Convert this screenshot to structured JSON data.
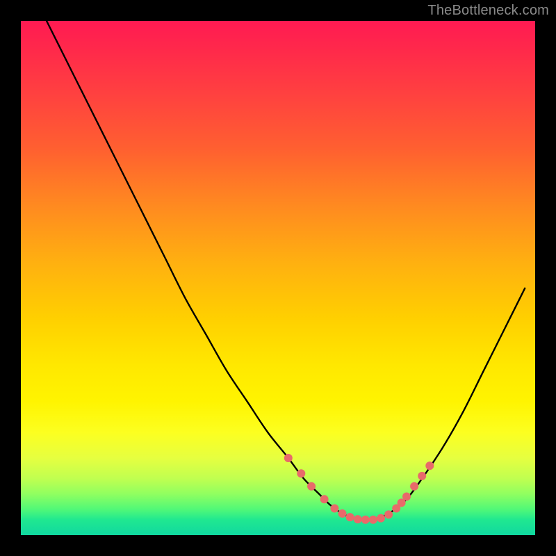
{
  "watermark": "TheBottleneck.com",
  "chart_data": {
    "type": "line",
    "title": "",
    "xlabel": "",
    "ylabel": "",
    "xlim": [
      0,
      100
    ],
    "ylim": [
      0,
      100
    ],
    "series": [
      {
        "name": "bottleneck-curve",
        "x": [
          5,
          8,
          12,
          16,
          20,
          24,
          28,
          32,
          36,
          40,
          44,
          48,
          52,
          55,
          58,
          60,
          62,
          64,
          66,
          68,
          70,
          72,
          75,
          78,
          82,
          86,
          90,
          94,
          98
        ],
        "y": [
          100,
          94,
          86,
          78,
          70,
          62,
          54,
          46,
          39,
          32,
          26,
          20,
          15,
          11,
          8,
          6,
          4.5,
          3.5,
          3,
          3,
          3.5,
          4.5,
          7,
          11,
          17,
          24,
          32,
          40,
          48
        ]
      }
    ],
    "markers": {
      "name": "highlight-dots",
      "color": "#e86a6a",
      "x": [
        52,
        54.5,
        56.5,
        59,
        61,
        62.5,
        64,
        65.5,
        67,
        68.5,
        70,
        71.5,
        73,
        74,
        75,
        76.5,
        78,
        79.5
      ],
      "y": [
        15,
        12,
        9.5,
        7,
        5.2,
        4.2,
        3.5,
        3.1,
        3,
        3,
        3.3,
        4,
        5.2,
        6.3,
        7.5,
        9.5,
        11.5,
        13.5
      ]
    },
    "gradient_stops": [
      {
        "pos": 0,
        "color": "#ff1a52"
      },
      {
        "pos": 25,
        "color": "#ff6030"
      },
      {
        "pos": 58,
        "color": "#ffd000"
      },
      {
        "pos": 80,
        "color": "#fcff20"
      },
      {
        "pos": 95,
        "color": "#50f878"
      },
      {
        "pos": 100,
        "color": "#10d8a0"
      }
    ]
  }
}
